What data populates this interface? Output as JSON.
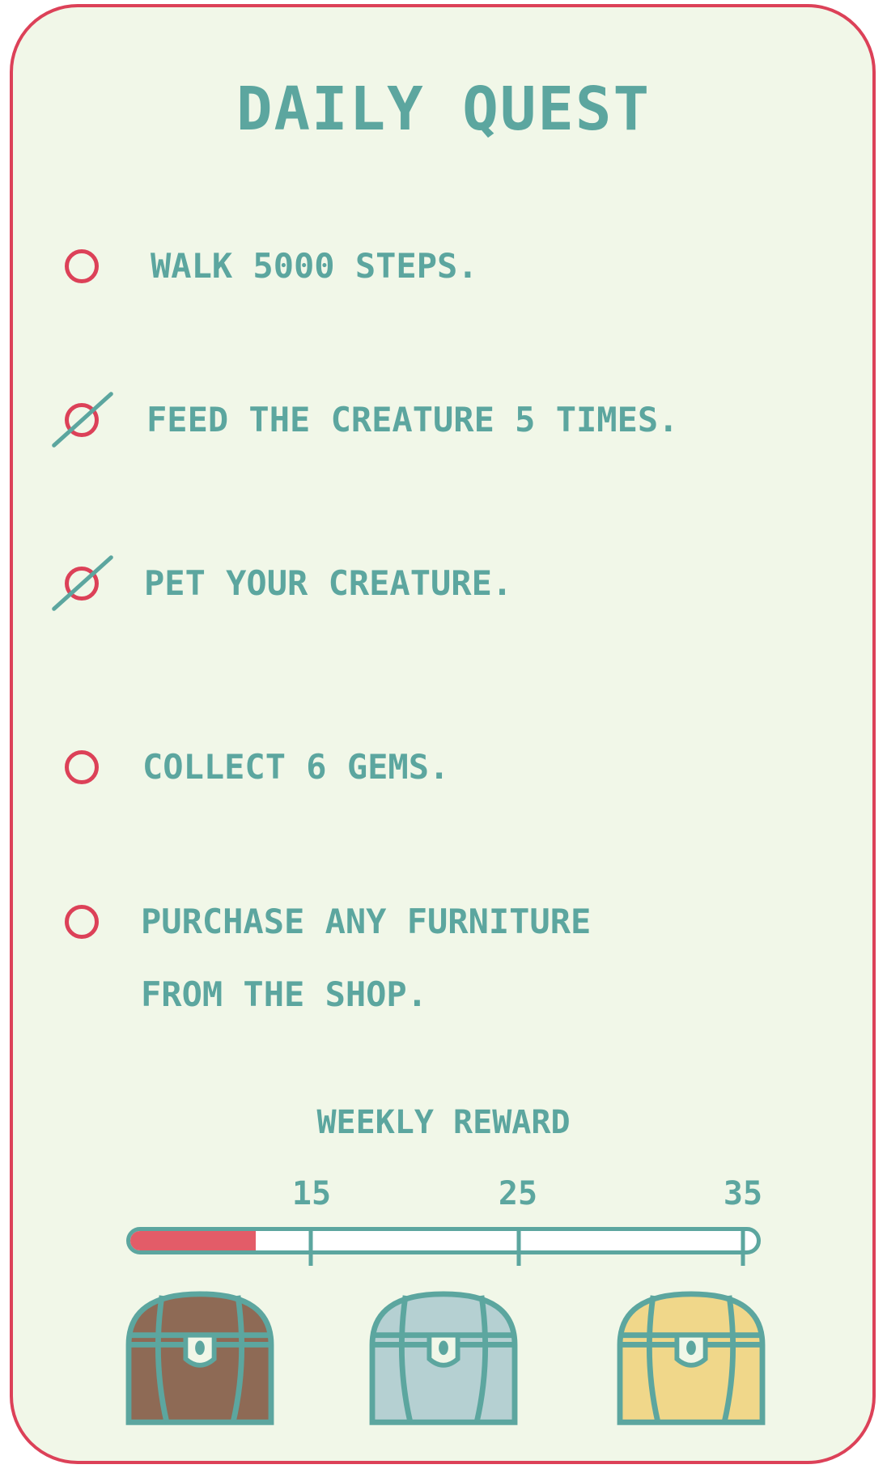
{
  "title": "DAILY QUEST",
  "quests": [
    {
      "text": "WALK 5000 STEPS.",
      "completed": false
    },
    {
      "text": "FEED THE CREATURE 5 TIMES.",
      "completed": true
    },
    {
      "text": "PET YOUR CREATURE.",
      "completed": true
    },
    {
      "text": "COLLECT 6 GEMS.",
      "completed": false
    },
    {
      "text": "PURCHASE ANY FURNITURE\nFROM THE SHOP.",
      "completed": false
    }
  ],
  "weekly": {
    "title": "WEEKLY REWARD",
    "progress_value": 7,
    "max_value": 35,
    "milestones": [
      {
        "label": "15",
        "value": 15
      },
      {
        "label": "25",
        "value": 25
      },
      {
        "label": "35",
        "value": 35
      }
    ],
    "chests": [
      {
        "name": "bronze-chest-icon",
        "color": "#8e6a55"
      },
      {
        "name": "silver-chest-icon",
        "color": "#b5d0d2"
      },
      {
        "name": "gold-chest-icon",
        "color": "#f0d78a"
      }
    ]
  },
  "colors": {
    "accent": "#5ca69f",
    "border": "#dc4158",
    "background": "#f1f7e8",
    "progress": "#e35c68"
  }
}
